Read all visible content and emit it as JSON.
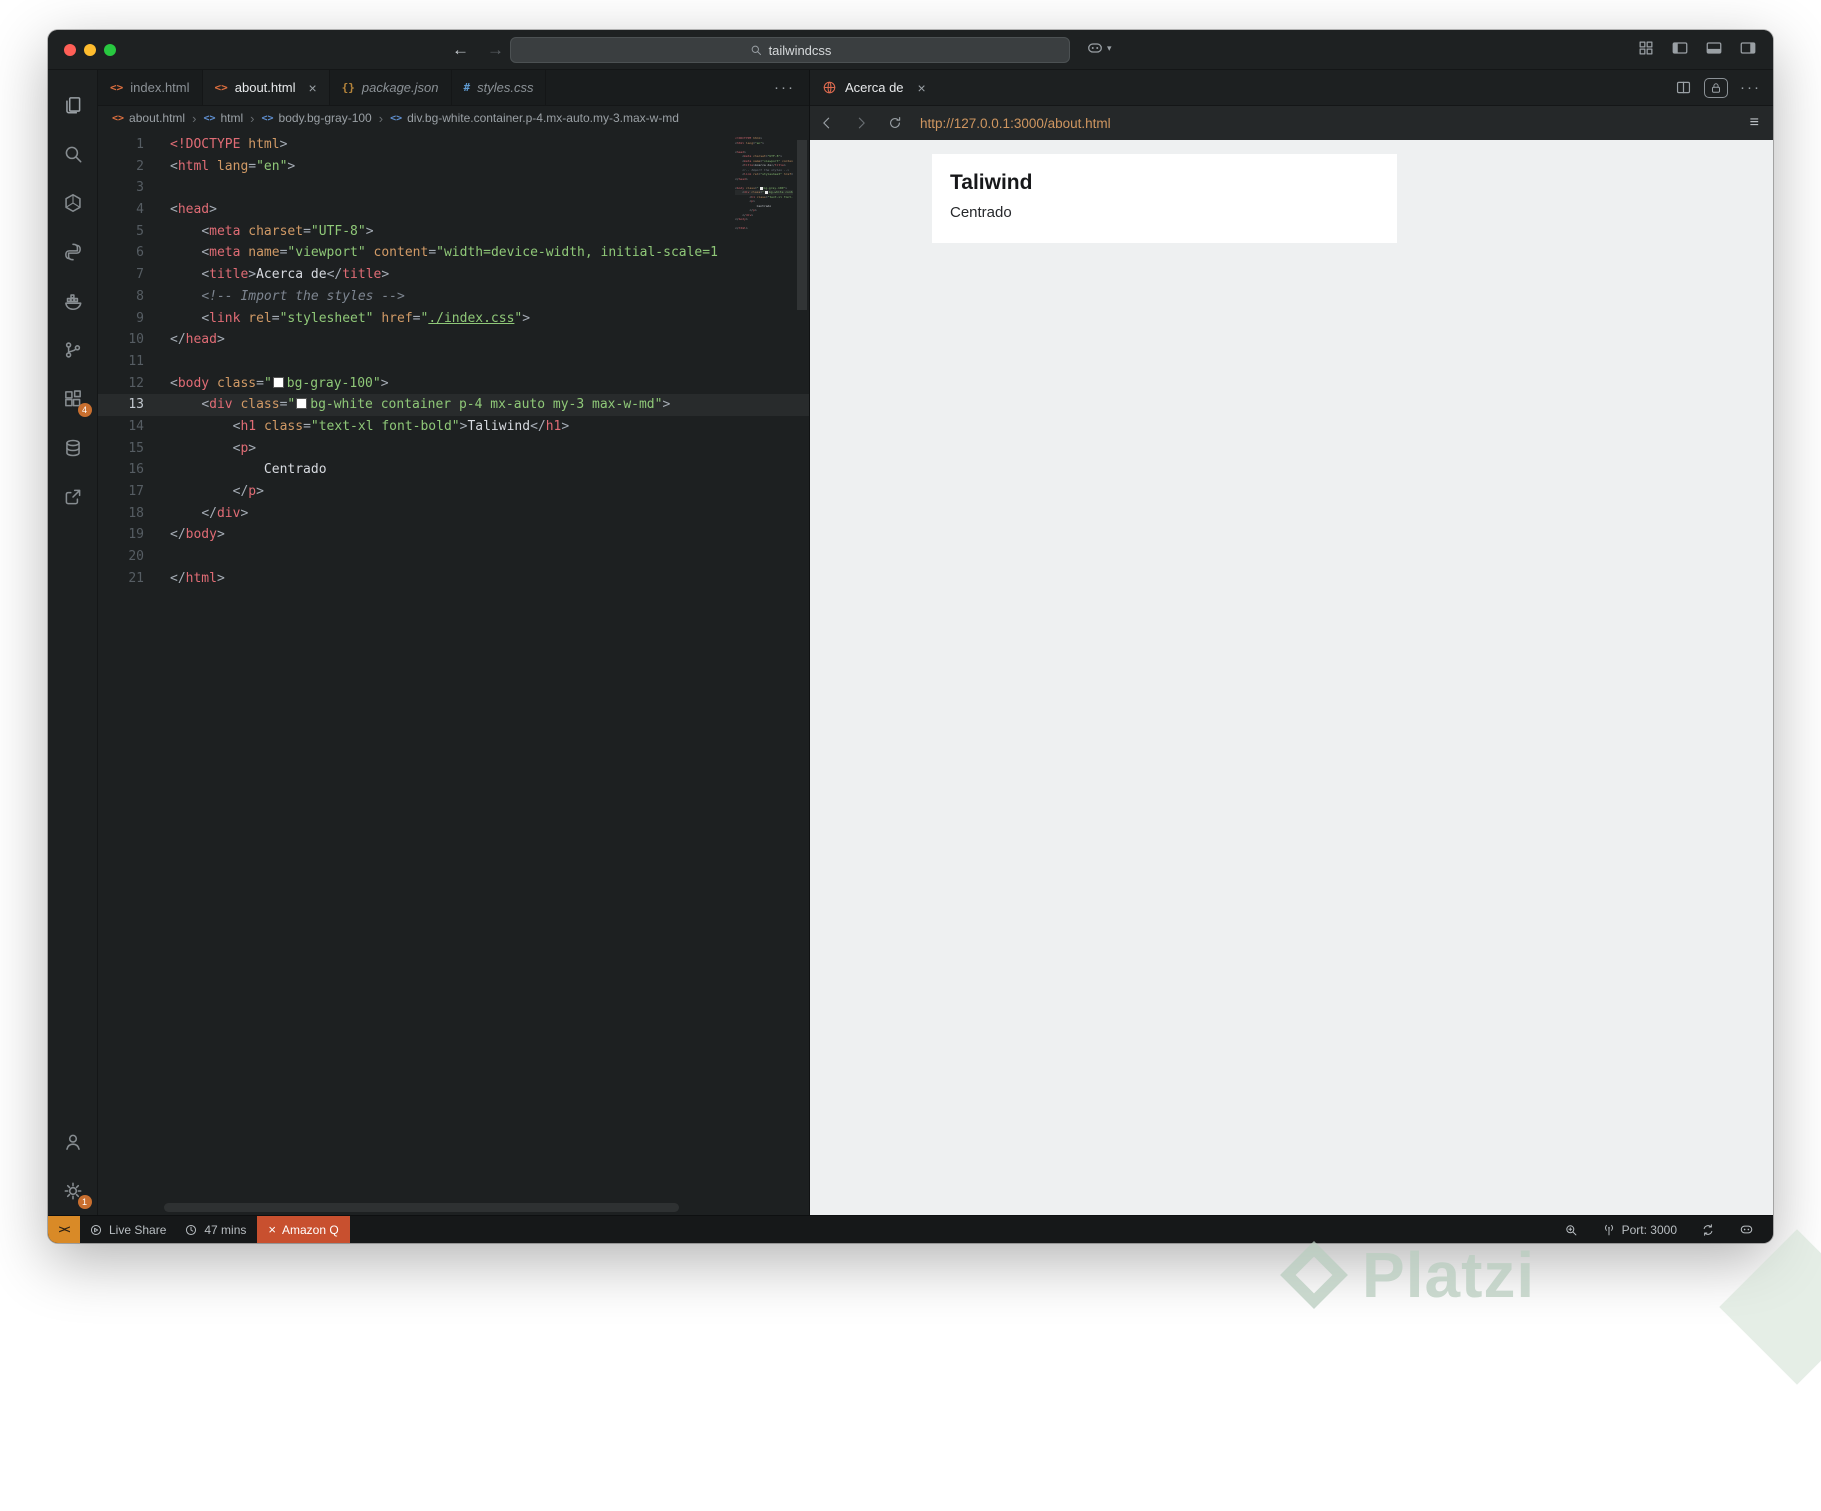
{
  "titlebar": {
    "search_value": "tailwindcss"
  },
  "activity_bar": {
    "extensions_badge": "4",
    "settings_badge": "1"
  },
  "editor": {
    "tabs": [
      {
        "label": "index.html",
        "icon": "<>",
        "icon_color": "#e0703f",
        "active": false,
        "italic": false,
        "closable": false
      },
      {
        "label": "about.html",
        "icon": "<>",
        "icon_color": "#e0703f",
        "active": true,
        "italic": false,
        "closable": true
      },
      {
        "label": "package.json",
        "icon": "{}",
        "icon_color": "#b8863b",
        "active": false,
        "italic": true,
        "closable": false
      },
      {
        "label": "styles.css",
        "icon": "#",
        "icon_color": "#5f9ad0",
        "active": false,
        "italic": true,
        "closable": false
      }
    ],
    "more_label": "···",
    "breadcrumb": [
      {
        "label": "about.html",
        "icon": "<>",
        "icon_color": "#e0703f"
      },
      {
        "label": "html",
        "icon": "<>",
        "icon_color": "#5f8fd0"
      },
      {
        "label": "body.bg-gray-100",
        "icon": "<>",
        "icon_color": "#5f8fd0"
      },
      {
        "label": "div.bg-white.container.p-4.mx-auto.my-3.max-w-md",
        "icon": "<>",
        "icon_color": "#5f8fd0"
      }
    ],
    "code": {
      "lines": [
        {
          "n": 1,
          "tokens": [
            [
              "t",
              "<!DOCTYPE"
            ],
            [
              "a",
              " html"
            ],
            [
              "p",
              ">"
            ]
          ]
        },
        {
          "n": 2,
          "tokens": [
            [
              "p",
              "<"
            ],
            [
              "t",
              "html"
            ],
            [
              "x",
              " "
            ],
            [
              "a",
              "lang"
            ],
            [
              "p",
              "="
            ],
            [
              "s",
              "\"en\""
            ],
            [
              "p",
              ">"
            ]
          ]
        },
        {
          "n": 3,
          "tokens": []
        },
        {
          "n": 4,
          "tokens": [
            [
              "p",
              "<"
            ],
            [
              "t",
              "head"
            ],
            [
              "p",
              ">"
            ]
          ]
        },
        {
          "n": 5,
          "tokens": [
            [
              "x",
              "    "
            ],
            [
              "p",
              "<"
            ],
            [
              "t",
              "meta"
            ],
            [
              "x",
              " "
            ],
            [
              "a",
              "charset"
            ],
            [
              "p",
              "="
            ],
            [
              "s",
              "\"UTF-8\""
            ],
            [
              "p",
              ">"
            ]
          ]
        },
        {
          "n": 6,
          "tokens": [
            [
              "x",
              "    "
            ],
            [
              "p",
              "<"
            ],
            [
              "t",
              "meta"
            ],
            [
              "x",
              " "
            ],
            [
              "a",
              "name"
            ],
            [
              "p",
              "="
            ],
            [
              "s",
              "\"viewport\""
            ],
            [
              "x",
              " "
            ],
            [
              "a",
              "content"
            ],
            [
              "p",
              "="
            ],
            [
              "s",
              "\"width=device-width, initial-scale=1"
            ]
          ]
        },
        {
          "n": 7,
          "tokens": [
            [
              "x",
              "    "
            ],
            [
              "p",
              "<"
            ],
            [
              "t",
              "title"
            ],
            [
              "p",
              ">"
            ],
            [
              "x",
              "Acerca de"
            ],
            [
              "p",
              "</"
            ],
            [
              "t",
              "title"
            ],
            [
              "p",
              ">"
            ]
          ]
        },
        {
          "n": 8,
          "tokens": [
            [
              "x",
              "    "
            ],
            [
              "c",
              "<!-- Import the styles -->"
            ]
          ]
        },
        {
          "n": 9,
          "tokens": [
            [
              "x",
              "    "
            ],
            [
              "p",
              "<"
            ],
            [
              "t",
              "link"
            ],
            [
              "x",
              " "
            ],
            [
              "a",
              "rel"
            ],
            [
              "p",
              "="
            ],
            [
              "s",
              "\"stylesheet\""
            ],
            [
              "x",
              " "
            ],
            [
              "a",
              "href"
            ],
            [
              "p",
              "="
            ],
            [
              "s",
              "\""
            ],
            [
              "u",
              "./index.css"
            ],
            [
              "s",
              "\""
            ],
            [
              "p",
              ">"
            ]
          ]
        },
        {
          "n": 10,
          "tokens": [
            [
              "p",
              "</"
            ],
            [
              "t",
              "head"
            ],
            [
              "p",
              ">"
            ]
          ]
        },
        {
          "n": 11,
          "tokens": []
        },
        {
          "n": 12,
          "tokens": [
            [
              "p",
              "<"
            ],
            [
              "t",
              "body"
            ],
            [
              "x",
              " "
            ],
            [
              "a",
              "class"
            ],
            [
              "p",
              "="
            ],
            [
              "s",
              "\""
            ],
            [
              "w",
              ""
            ],
            [
              "s",
              "bg-gray-100\""
            ],
            [
              "p",
              ">"
            ]
          ]
        },
        {
          "n": 13,
          "active": true,
          "tokens": [
            [
              "x",
              "    "
            ],
            [
              "p",
              "<"
            ],
            [
              "t",
              "div"
            ],
            [
              "x",
              " "
            ],
            [
              "a",
              "class"
            ],
            [
              "p",
              "="
            ],
            [
              "s",
              "\""
            ],
            [
              "w",
              ""
            ],
            [
              "s",
              "bg-white container p-4 mx-auto my-3 max-w-md\""
            ],
            [
              "p",
              ">"
            ]
          ]
        },
        {
          "n": 14,
          "tokens": [
            [
              "x",
              "        "
            ],
            [
              "p",
              "<"
            ],
            [
              "t",
              "h1"
            ],
            [
              "x",
              " "
            ],
            [
              "a",
              "class"
            ],
            [
              "p",
              "="
            ],
            [
              "s",
              "\"text-xl font-bold\""
            ],
            [
              "p",
              ">"
            ],
            [
              "x",
              "Taliwind"
            ],
            [
              "p",
              "</"
            ],
            [
              "t",
              "h1"
            ],
            [
              "p",
              ">"
            ]
          ]
        },
        {
          "n": 15,
          "tokens": [
            [
              "x",
              "        "
            ],
            [
              "p",
              "<"
            ],
            [
              "t",
              "p"
            ],
            [
              "p",
              ">"
            ]
          ]
        },
        {
          "n": 16,
          "tokens": [
            [
              "x",
              "            Centrado"
            ]
          ]
        },
        {
          "n": 17,
          "tokens": [
            [
              "x",
              "        "
            ],
            [
              "p",
              "</"
            ],
            [
              "t",
              "p"
            ],
            [
              "p",
              ">"
            ]
          ]
        },
        {
          "n": 18,
          "tokens": [
            [
              "x",
              "    "
            ],
            [
              "p",
              "</"
            ],
            [
              "t",
              "div"
            ],
            [
              "p",
              ">"
            ]
          ]
        },
        {
          "n": 19,
          "tokens": [
            [
              "p",
              "</"
            ],
            [
              "t",
              "body"
            ],
            [
              "p",
              ">"
            ]
          ]
        },
        {
          "n": 20,
          "tokens": []
        },
        {
          "n": 21,
          "tokens": [
            [
              "p",
              "</"
            ],
            [
              "t",
              "html"
            ],
            [
              "p",
              ">"
            ]
          ]
        }
      ]
    }
  },
  "panel": {
    "tab_label": "Acerca de",
    "more_label": "···",
    "url": "http://127.0.0.1:3000/about.html",
    "preview": {
      "title": "Taliwind",
      "body": "Centrado"
    }
  },
  "statusbar": {
    "remote_glyph": "><",
    "live_share": "Live Share",
    "session_time": "47 mins",
    "amazon_q_close": "×",
    "amazon_q": "Amazon Q",
    "port": "Port: 3000"
  },
  "watermark": {
    "text": "Platzi"
  },
  "colors": {
    "tag": "#e06c75",
    "attr": "#d19a66",
    "string": "#8fc878",
    "url_text": "#cf9660",
    "amazon_q_bg": "#c8502f",
    "remote_bg": "#d98a27",
    "badge_bg": "#c96f2f",
    "preview_bg": "#eef0f1",
    "editor_bg": "#1d2021"
  }
}
